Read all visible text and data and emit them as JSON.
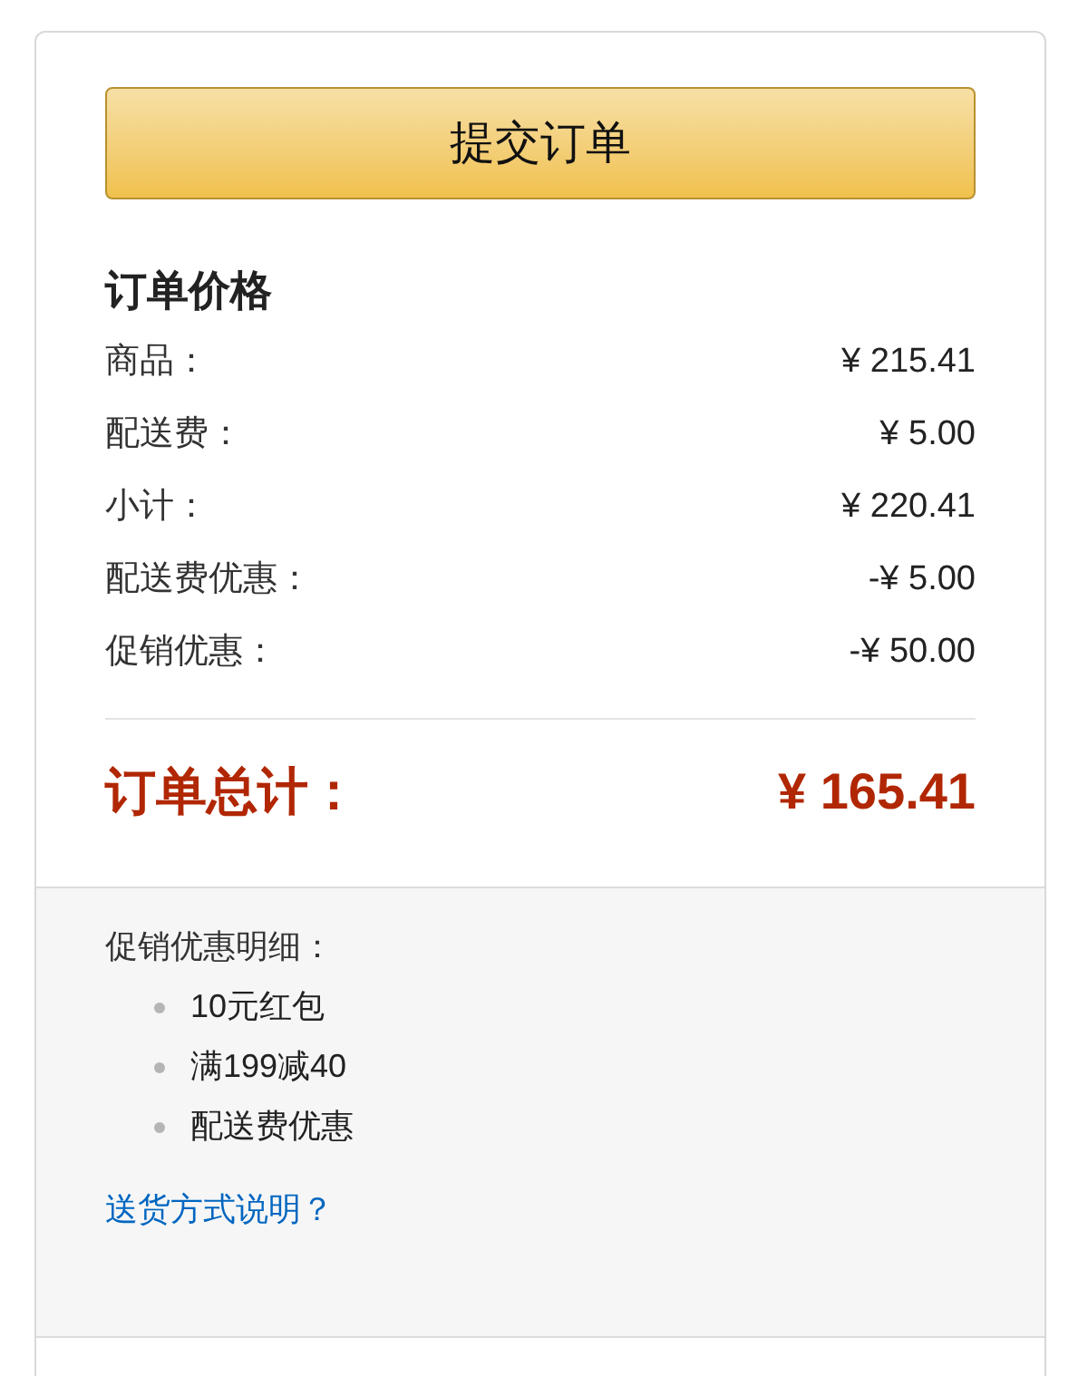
{
  "submit_button": {
    "label": "提交订单"
  },
  "price_summary": {
    "title": "订单价格",
    "rows": [
      {
        "label": "商品：",
        "value": "¥ 215.41"
      },
      {
        "label": "配送费：",
        "value": "¥ 5.00"
      },
      {
        "label": "小计：",
        "value": "¥ 220.41"
      },
      {
        "label": "配送费优惠：",
        "value": "-¥ 5.00"
      },
      {
        "label": "促销优惠：",
        "value": "-¥ 50.00"
      }
    ],
    "total": {
      "label": "订单总计：",
      "value": "¥ 165.41"
    }
  },
  "promotion_details": {
    "title": "促销优惠明细：",
    "items": [
      "10元红包",
      "满199减40",
      "配送费优惠"
    ],
    "link": "送货方式说明？"
  }
}
